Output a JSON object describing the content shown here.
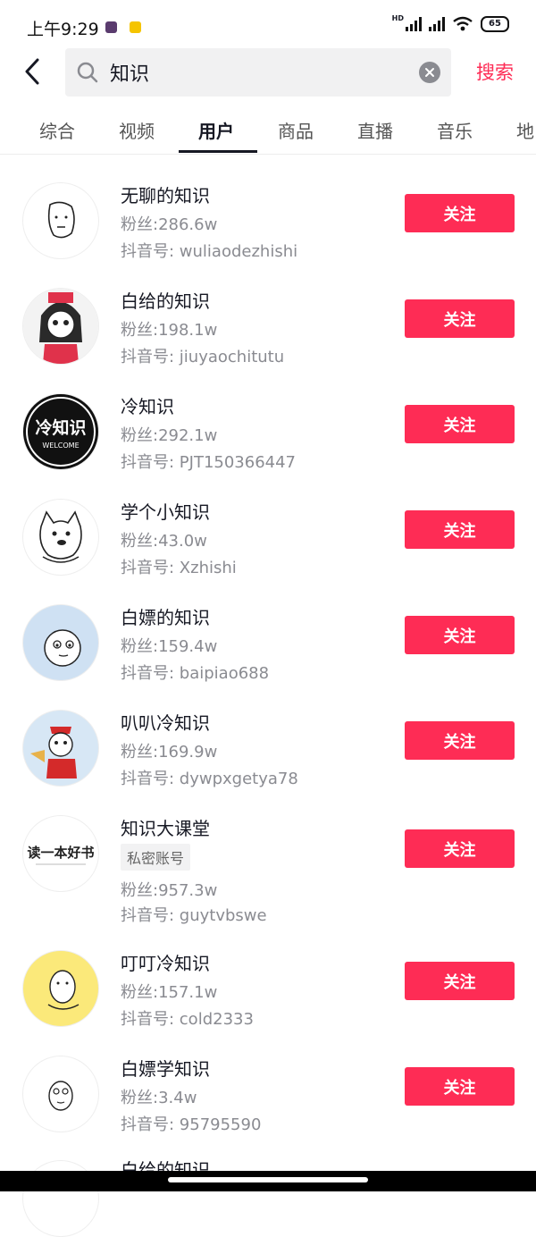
{
  "status_bar": {
    "time": "上午9:29",
    "network": "HD",
    "battery": "65"
  },
  "search": {
    "query": "知识",
    "submit_label": "搜索"
  },
  "tabs": [
    {
      "label": "综合"
    },
    {
      "label": "视频"
    },
    {
      "label": "用户",
      "active": true
    },
    {
      "label": "商品"
    },
    {
      "label": "直播"
    },
    {
      "label": "音乐"
    },
    {
      "label": "地"
    }
  ],
  "avatar_logo_text": {
    "line1": "冷知识",
    "line2": "WELCOME",
    "book": "读一本好书"
  },
  "users": [
    {
      "name": "无聊的知识",
      "fans": "粉丝:286.6w",
      "id": "抖音号: wuliaodezhishi",
      "follow": "关注"
    },
    {
      "name": "白给的知识",
      "fans": "粉丝:198.1w",
      "id": "抖音号: jiuyaochitutu",
      "follow": "关注"
    },
    {
      "name": "冷知识",
      "fans": "粉丝:292.1w",
      "id": "抖音号: PJT150366447",
      "follow": "关注"
    },
    {
      "name": "学个小知识",
      "fans": "粉丝:43.0w",
      "id": "抖音号: Xzhishi",
      "follow": "关注"
    },
    {
      "name": "白嫖的知识",
      "fans": "粉丝:159.4w",
      "id": "抖音号: baipiao688",
      "follow": "关注"
    },
    {
      "name": "叭叭冷知识",
      "fans": "粉丝:169.9w",
      "id": "抖音号: dywpxgetya78",
      "follow": "关注"
    },
    {
      "name": "知识大课堂",
      "badge": "私密账号",
      "fans": "粉丝:957.3w",
      "id": "抖音号: guytvbswe",
      "follow": "关注"
    },
    {
      "name": "叮叮冷知识",
      "fans": "粉丝:157.1w",
      "id": "抖音号: cold2333",
      "follow": "关注"
    },
    {
      "name": "白嫖学知识",
      "fans": "粉丝:3.4w",
      "id": "抖音号: 95795590",
      "follow": "关注"
    }
  ],
  "partial_user": {
    "name": "白给的知识"
  },
  "colors": {
    "accent": "#fe2c55",
    "text": "#161823",
    "muted": "#8a8b91"
  }
}
